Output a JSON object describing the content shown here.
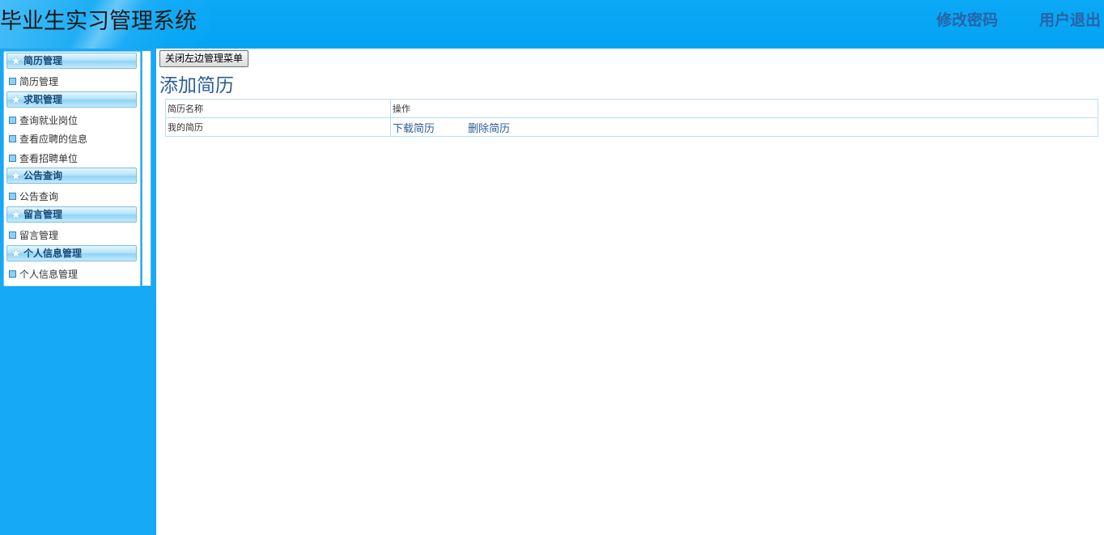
{
  "header": {
    "title": "毕业生实习管理系统",
    "change_password": "修改密码",
    "logout": "用户退出"
  },
  "sidebar": {
    "groups": [
      {
        "title": "简历管理",
        "items": [
          "简历管理"
        ]
      },
      {
        "title": "求职管理",
        "items": [
          "查询就业岗位",
          "查看应聘的信息",
          "查看招聘单位"
        ]
      },
      {
        "title": "公告查询",
        "items": [
          "公告查询"
        ]
      },
      {
        "title": "留言管理",
        "items": [
          "留言管理"
        ]
      },
      {
        "title": "个人信息管理",
        "items": [
          "个人信息管理"
        ]
      }
    ]
  },
  "main": {
    "toggle_button": "关闭左边管理菜单",
    "page_title": "添加简历",
    "table": {
      "headers": [
        "简历名称",
        "操作"
      ],
      "rows": [
        {
          "name": "我的简历",
          "actions": [
            "下载简历",
            "删除简历"
          ]
        }
      ]
    }
  }
}
